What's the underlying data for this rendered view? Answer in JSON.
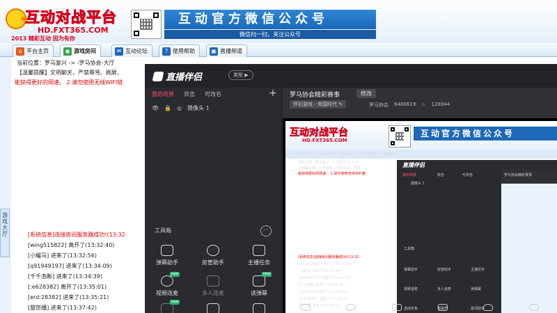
{
  "banner": {
    "logo_title": "互动对战平台",
    "logo_url": "HD.FXT365.COM",
    "logo_slogan": "2013 精彩互动 因为有你",
    "wechat_title": "互动官方微信公众号",
    "wechat_subtitle": "微信扫一扫，关注公众号"
  },
  "tabs": [
    {
      "label": "平台主页",
      "icon": "home-icon",
      "color": "#e05a1c"
    },
    {
      "label": "游戏房间",
      "icon": "game-room-icon",
      "color": "#3aa34a"
    },
    {
      "label": "互动论坛",
      "icon": "forum-icon",
      "color": "#1d68b8"
    },
    {
      "label": "使用帮助",
      "icon": "help-icon",
      "color": "#1d68b8"
    },
    {
      "label": "直播频道",
      "icon": "live-channel-icon",
      "color": "#1d68b8"
    }
  ],
  "main": {
    "breadcrumb": "当前位置：罗马复兴 -> -罗马协会-大厅",
    "tip": "【温馨提醒】文明聊天，严禁辱骂、刷屏、",
    "warning": "能获得更好的网速。    2.请勿使用无线WIFI链",
    "side_label": "游戏大厅",
    "chat": [
      {
        "text": "[系统信息]连接房间服务器成功!(13:32:",
        "system": true
      },
      {
        "text": "[wing515822] 离开了(13:32:40)",
        "system": false
      },
      {
        "text": "[小耀马] 进来了(13:32:56)",
        "system": false
      },
      {
        "text": "[q91949197] 进来了(13:34:09)",
        "system": false
      },
      {
        "text": "[千千泡断] 进来了(13:34:39)",
        "system": false
      },
      {
        "text": "[:e628382] 离开了(13:35:01)",
        "system": false
      },
      {
        "text": "[erd:28382] 进来了(13:35:21)",
        "system": false
      },
      {
        "text": "[甜您播] 进来了(13:37:42)",
        "system": false
      }
    ]
  },
  "zhibo": {
    "app_name": "直播伴侣",
    "type_label": "类型 ▶",
    "scene_tabs": [
      "我的场景",
      "双击",
      "可改名"
    ],
    "add": "+",
    "scene_item": "摄像头 1",
    "tools_label": "工具箱",
    "tools_more": "···",
    "tools": [
      {
        "label": "弹幕助手",
        "icon": "danmaku-icon",
        "dim": false,
        "new": false
      },
      {
        "label": "房管助手",
        "icon": "room-admin-icon",
        "dim": false,
        "new": false
      },
      {
        "label": "主播任务",
        "icon": "task-icon",
        "dim": false,
        "new": false
      },
      {
        "label": "视频连麦",
        "icon": "video-link-icon",
        "dim": false,
        "new": true
      },
      {
        "label": "多人连麦",
        "icon": "multi-link-icon",
        "dim": true,
        "new": false
      },
      {
        "label": "读弹幕",
        "icon": "read-danmaku-icon",
        "dim": false,
        "new": true
      },
      {
        "label": "虚拟形象",
        "icon": "avatar-icon",
        "dim": true,
        "new": true
      },
      {
        "label": "弹幕秀",
        "icon": "danmaku-show-icon",
        "dim": false,
        "new": false
      },
      {
        "label": "歌词助手",
        "icon": "lyrics-icon",
        "dim": false,
        "new": false
      }
    ],
    "room_name": "罗马协会精彩赛事",
    "edit_label": "修改",
    "category": "怀旧游戏 - 帝国时代 ✎",
    "owner": "罗马协会",
    "room_id": "6480619",
    "popularity": "128044"
  },
  "mini": {
    "logo": "互动对战平台",
    "wechat": "互动官方微信公众号",
    "zb_name": "直播伴侣"
  }
}
